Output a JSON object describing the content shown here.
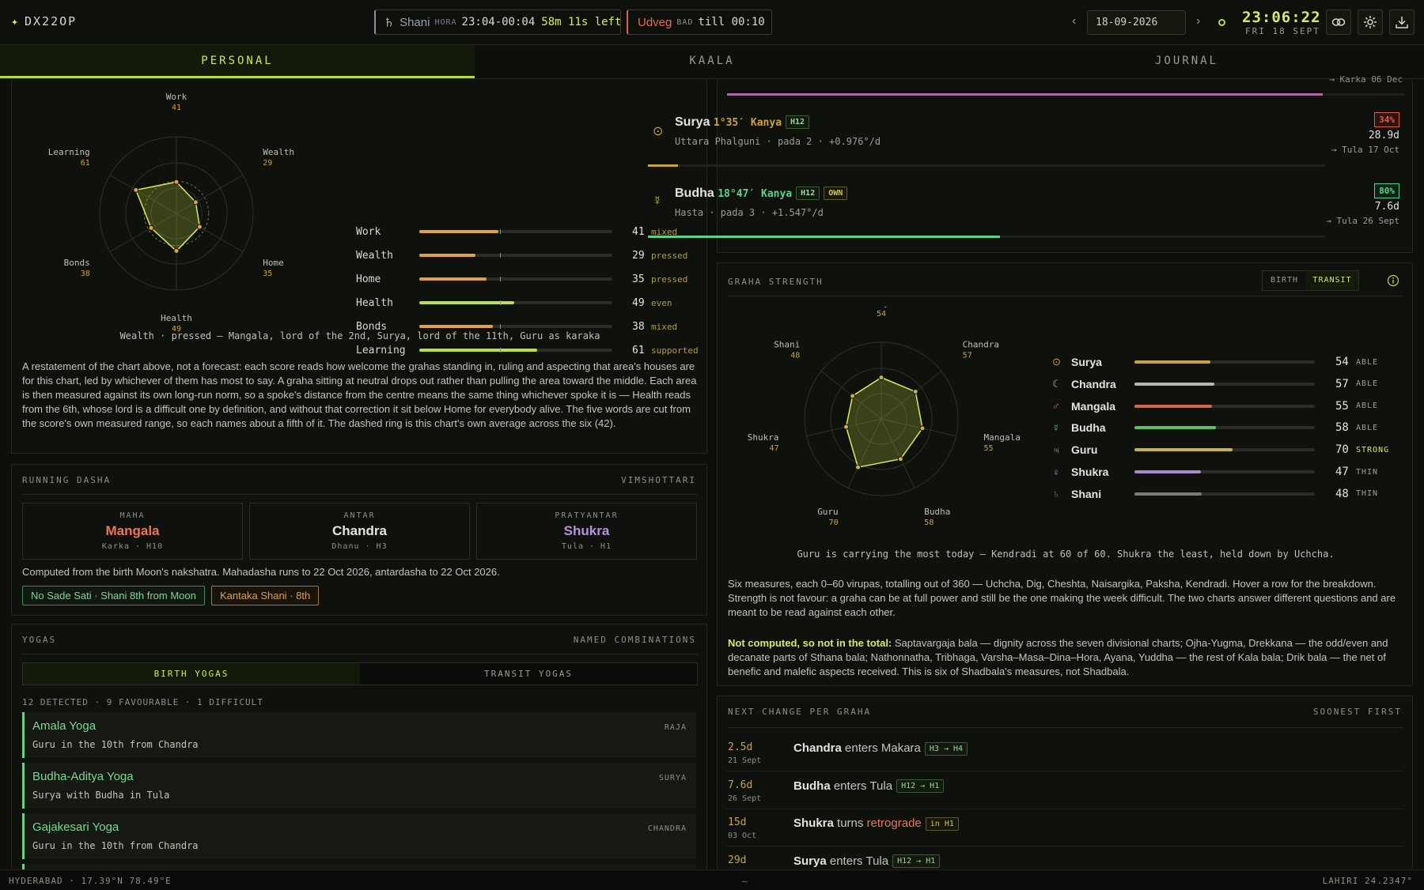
{
  "app": {
    "name": "DX22OP"
  },
  "hora": {
    "planet": "Shani",
    "label": "HORA",
    "range": "23:04-00:04",
    "remaining": "58m 11s left"
  },
  "choghadiya": {
    "name": "Udveg",
    "quality": "BAD",
    "until": "till 00:10"
  },
  "date": {
    "value": "18-09-2026",
    "prev": "‹",
    "next": "›"
  },
  "clock": {
    "time": "23:06:22",
    "date": "FRI 18 SEPT"
  },
  "tabs": [
    "PERSONAL",
    "KAALA",
    "JOURNAL"
  ],
  "life_areas": {
    "radar_labels": [
      {
        "name": "Work",
        "value": "41"
      },
      {
        "name": "Wealth",
        "value": "29"
      },
      {
        "name": "Home",
        "value": "35"
      },
      {
        "name": "Health",
        "value": "49"
      },
      {
        "name": "Bonds",
        "value": "38"
      },
      {
        "name": "Learning",
        "value": "61"
      }
    ],
    "radar_values": [
      41,
      29,
      35,
      49,
      38,
      61
    ],
    "radar_average": 42,
    "rows": [
      {
        "name": "Work",
        "value": "41",
        "word": "mixed",
        "pct": 41,
        "color": "#e0a04a"
      },
      {
        "name": "Wealth",
        "value": "29",
        "word": "pressed",
        "pct": 29,
        "color": "#e0a04a"
      },
      {
        "name": "Home",
        "value": "35",
        "word": "pressed",
        "pct": 35,
        "color": "#e0a04a"
      },
      {
        "name": "Health",
        "value": "49",
        "word": "even",
        "pct": 49,
        "color": "#b7de4c"
      },
      {
        "name": "Bonds",
        "value": "38",
        "word": "mixed",
        "pct": 38,
        "color": "#e0a04a"
      },
      {
        "name": "Learning",
        "value": "61",
        "word": "supported",
        "pct": 61,
        "color": "#b7de4c"
      }
    ],
    "caption": "Wealth · pressed — Mangala, lord of the 2nd, Surya, lord of the 11th, Guru as karaka",
    "description": "A restatement of the chart above, not a forecast: each score reads how welcome the grahas standing in, ruling and aspecting that area's houses are for this chart, led by whichever of them has most to say. A graha sitting at neutral drops out rather than pulling the area toward the middle. Each area is then measured against its own long-run norm, so a spoke's distance from the centre means the same thing whichever spoke it is — Health reads from the 6th, whose lord is a difficult one by definition, and without that correction it sit below Home for everybody alive. The five words are cut from the score's own measured range, so each names about a fifth of it. The dashed ring is this chart's own average across the six (42)."
  },
  "dasha": {
    "title": "RUNNING DASHA",
    "system": "VIMSHOTTARI",
    "boxes": [
      {
        "kind": "MAHA",
        "name": "Mangala",
        "sub": "Karka · H10",
        "color": "#e8785c"
      },
      {
        "kind": "ANTAR",
        "name": "Chandra",
        "sub": "Dhanu · H3",
        "color": "#e4e5da"
      },
      {
        "kind": "PRATYANTAR",
        "name": "Shukra",
        "sub": "Tula · H1",
        "color": "#b890e0"
      }
    ],
    "note": "Computed from the birth Moon's nakshatra. Mahadasha runs to 22 Oct 2026, antardasha to 22 Oct 2026.",
    "chips": [
      "No Sade Sati · Shani 8th from Moon",
      "Kantaka Shani · 8th"
    ]
  },
  "yogas": {
    "title": "YOGAS",
    "subtitle": "NAMED COMBINATIONS",
    "tabs": [
      "BIRTH YOGAS",
      "TRANSIT YOGAS"
    ],
    "summary": "12 DETECTED · 9 FAVOURABLE · 1 DIFFICULT",
    "items": [
      {
        "name": "Amala Yoga",
        "desc": "Guru in the 10th from Chandra",
        "category": "RAJA"
      },
      {
        "name": "Budha-Aditya Yoga",
        "desc": "Surya with Budha in Tula",
        "category": "SURYA"
      },
      {
        "name": "Gajakesari Yoga",
        "desc": "Guru in the 10th from Chandra",
        "category": "CHANDRA"
      }
    ]
  },
  "transits": {
    "clipped_text": "→ Karka 06 Dec",
    "rows": [
      {
        "glyph": "⊙",
        "name": "Surya",
        "deg": "1°35′ Kanya",
        "house": "H12",
        "own": "",
        "sub": "Uttara Phalguni · pada 2 · +0.976°/d",
        "pct": "34%",
        "pct_num": 34,
        "pct_color": "#e05a50",
        "days": "28.9d",
        "next": "→ Tula 17 Oct",
        "bar_color": "#c9a43e",
        "glyph_color": "#c9a43e"
      },
      {
        "glyph": "☿",
        "name": "Budha",
        "deg": "18°47′ Kanya",
        "house": "H12",
        "own": "OWN",
        "sub": "Hasta · pada 3 · +1.547°/d",
        "pct": "80%",
        "pct_num": 80,
        "pct_color": "#5ed08a",
        "days": "7.6d",
        "next": "→ Tula 26 Sept",
        "bar_color": "#5ed08a",
        "glyph_color": "#b7de4c"
      }
    ],
    "top_bar_pct": 88
  },
  "graha_strength": {
    "title": "GRAHA STRENGTH",
    "toggle": [
      "BIRTH",
      "TRANSIT"
    ],
    "radar_labels": [
      {
        "name": "Surya",
        "value": "54"
      },
      {
        "name": "Chandra",
        "value": "57"
      },
      {
        "name": "Mangala",
        "value": "55"
      },
      {
        "name": "Budha",
        "value": "58"
      },
      {
        "name": "Guru",
        "value": "70"
      },
      {
        "name": "Shukra",
        "value": "47"
      },
      {
        "name": "Shani",
        "value": "48"
      }
    ],
    "radar_values": [
      54,
      57,
      55,
      58,
      70,
      47,
      48
    ],
    "rows": [
      {
        "glyph": "⊙",
        "name": "Surya",
        "value": "54",
        "word": "ABLE",
        "pct": 54,
        "color": "#c9a43e"
      },
      {
        "glyph": "☾",
        "name": "Chandra",
        "value": "57",
        "word": "ABLE",
        "pct": 57,
        "color": "#b6b8ae"
      },
      {
        "glyph": "♂",
        "name": "Mangala",
        "value": "55",
        "word": "ABLE",
        "pct": 55,
        "color": "#d8614f"
      },
      {
        "glyph": "☿",
        "name": "Budha",
        "value": "58",
        "word": "ABLE",
        "pct": 58,
        "color": "#5ec060"
      },
      {
        "glyph": "♃",
        "name": "Guru",
        "value": "70",
        "word": "STRONG",
        "pct": 70,
        "color": "#c9b050"
      },
      {
        "glyph": "♀",
        "name": "Shukra",
        "value": "47",
        "word": "THIN",
        "pct": 47,
        "color": "#a988d0"
      },
      {
        "glyph": "♄",
        "name": "Shani",
        "value": "48",
        "word": "THIN",
        "pct": 48,
        "color": "#7a7c76"
      }
    ],
    "caption": "Guru is carrying the most today — Kendradi at 60 of 60. Shukra the least, held down by Uchcha.",
    "description": "Six measures, each 0–60 virupas, totalling out of 360 — Uchcha, Dig, Cheshta, Naisargika, Paksha, Kendradi. Hover a row for the breakdown. Strength is not favour: a graha can be at full power and still be the one making the week difficult. The two charts answer different questions and are meant to be read against each other.",
    "note_title": "Not computed, so not in the total:",
    "note_body": " Saptavargaja bala — dignity across the seven divisional charts; Ojha-Yugma, Drekkana — the odd/even and decanate parts of Sthana bala; Nathonnatha, Tribhaga, Varsha–Masa–Dina–Hora, Ayana, Yuddha — the rest of Kala bala; Drik bala — the net of benefic and malefic aspects received. This is six of Shadbala's measures, not Shadbala."
  },
  "next_change": {
    "title": "NEXT CHANGE PER GRAHA",
    "order": "SOONEST FIRST",
    "rows": [
      {
        "days": "2.5d",
        "date": "21 Sept",
        "planet": "Chandra",
        "verb": " enters Makara",
        "tag": "H3 → H4"
      },
      {
        "days": "7.6d",
        "date": "26 Sept",
        "planet": "Budha",
        "verb": " enters Tula",
        "tag": "H12 → H1"
      },
      {
        "days": "15d",
        "date": "03 Oct",
        "planet": "Shukra",
        "verb": " turns ",
        "accent": "retrograde",
        "tag": "in H1"
      },
      {
        "days": "29d",
        "date": "",
        "planet": "Surya",
        "verb": " enters Tula",
        "tag": "H12 → H1"
      }
    ]
  },
  "status": {
    "location": "HYDERABAD · 17.39°N 78.49°E",
    "center": "—",
    "ayanamsa": "LAHIRI 24.2347°"
  }
}
